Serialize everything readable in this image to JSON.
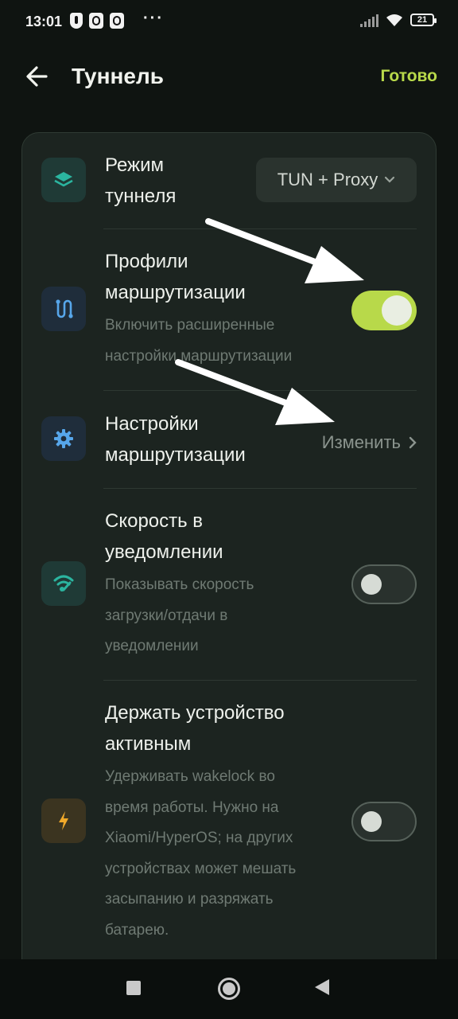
{
  "status_bar": {
    "time": "13:01",
    "dots": "···",
    "battery": "21"
  },
  "header": {
    "title": "Туннель",
    "done_label": "Готово"
  },
  "settings": {
    "tunnel_mode": {
      "title_line1": "Режим",
      "title_line2": "туннеля",
      "value": "TUN + Proxy",
      "icon": "layers-icon"
    },
    "routing_profiles": {
      "title_line1": "Профили",
      "title_line2": "маршрутизации",
      "sub_line1": "Включить расширенные",
      "sub_line2": "настройки маршрутизации",
      "enabled": true,
      "icon": "route-icon"
    },
    "routing_settings": {
      "title_line1": "Настройки",
      "title_line2": "маршрутизации",
      "action": "Изменить",
      "icon": "gear-icon"
    },
    "speed_notification": {
      "title_line1": "Скорость в",
      "title_line2": "уведомлении",
      "sub_line1": "Показывать скорость",
      "sub_line2": "загрузки/отдачи в",
      "sub_line3": "уведомлении",
      "enabled": false,
      "icon": "speed-icon"
    },
    "keep_awake": {
      "title_line1": "Держать устройство",
      "title_line2": "активным",
      "sub_line1": "Удерживать wakelock во",
      "sub_line2": "время работы. Нужно на",
      "sub_line3": "Xiaomi/HyperOS; на других",
      "sub_line4": "устройствах может мешать",
      "sub_line5": "засыпанию и разряжать",
      "sub_line6": "батарею.",
      "enabled": false,
      "icon": "bolt-icon"
    }
  },
  "colors": {
    "accent": "#b8d94a",
    "background": "#0f1411",
    "card": "#1c2420"
  }
}
